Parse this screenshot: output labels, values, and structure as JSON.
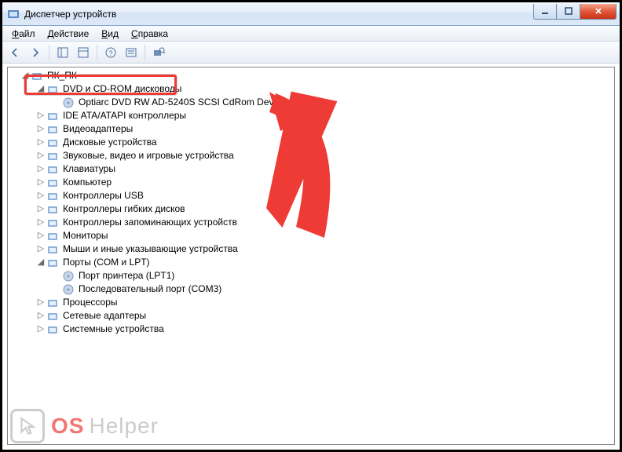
{
  "window": {
    "title": "Диспетчер устройств"
  },
  "menu": {
    "file": {
      "label": "Файл",
      "underline": "Ф"
    },
    "action": {
      "label": "Действие",
      "underline": "Д"
    },
    "view": {
      "label": "Вид",
      "underline": "В"
    },
    "help": {
      "label": "Справка",
      "underline": "С"
    }
  },
  "tree": {
    "root": {
      "label": "ПК_ПК",
      "expanded": true
    },
    "items": [
      {
        "label": "DVD и CD-ROM дисководы",
        "expanded": true,
        "children": [
          {
            "label": "Optiarc DVD RW AD-5240S SCSI CdRom Device"
          }
        ]
      },
      {
        "label": "IDE ATA/ATAPI контроллеры",
        "expanded": false
      },
      {
        "label": "Видеоадаптеры",
        "expanded": false
      },
      {
        "label": "Дисковые устройства",
        "expanded": false
      },
      {
        "label": "Звуковые, видео и игровые устройства",
        "expanded": false
      },
      {
        "label": "Клавиатуры",
        "expanded": false
      },
      {
        "label": "Компьютер",
        "expanded": false
      },
      {
        "label": "Контроллеры USB",
        "expanded": false
      },
      {
        "label": "Контроллеры гибких дисков",
        "expanded": false
      },
      {
        "label": "Контроллеры запоминающих устройств",
        "expanded": false
      },
      {
        "label": "Мониторы",
        "expanded": false
      },
      {
        "label": "Мыши и иные указывающие устройства",
        "expanded": false
      },
      {
        "label": "Порты (COM и LPT)",
        "expanded": true,
        "children": [
          {
            "label": "Порт принтера (LPT1)"
          },
          {
            "label": "Последовательный порт (COM3)"
          }
        ]
      },
      {
        "label": "Процессоры",
        "expanded": false
      },
      {
        "label": "Сетевые адаптеры",
        "expanded": false
      },
      {
        "label": "Системные устройства",
        "expanded": false
      }
    ]
  },
  "watermark": {
    "brand1": "OS",
    "brand2": "Helper"
  }
}
